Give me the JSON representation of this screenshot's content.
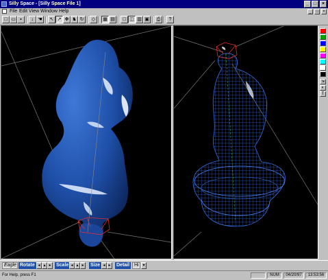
{
  "window": {
    "title": "Silly Space - [Silly Space File 1]"
  },
  "title_buttons": [
    "_",
    "□",
    "×"
  ],
  "menu": {
    "items": [
      "File",
      "Edit",
      "View",
      "Window",
      "Help"
    ]
  },
  "mdi_buttons": [
    "_",
    "□",
    "×"
  ],
  "toolbar": {
    "icons": [
      {
        "name": "new-file-icon",
        "glyph": "□"
      },
      {
        "name": "open-file-icon",
        "glyph": "▭"
      },
      {
        "name": "save-icon",
        "glyph": "▪"
      },
      {
        "name": "run-icon",
        "glyph": "↓"
      },
      {
        "name": "hand-icon",
        "glyph": "☚"
      },
      {
        "name": "select-arrow-icon",
        "glyph": "↖"
      },
      {
        "name": "pointer-icon",
        "glyph": "↗"
      },
      {
        "name": "fly-icon",
        "glyph": "✥"
      },
      {
        "name": "walk-icon",
        "glyph": "♞"
      },
      {
        "name": "rotate-icon",
        "glyph": "↻"
      },
      {
        "name": "view-toggle-icon",
        "glyph": "◇"
      },
      {
        "name": "grid-icon",
        "glyph": "▦"
      },
      {
        "name": "wireframe-icon",
        "glyph": "▤"
      },
      {
        "name": "single-view-icon",
        "glyph": "□"
      },
      {
        "name": "split-view-icon",
        "glyph": "◫"
      },
      {
        "name": "quad-view-icon",
        "glyph": "▥"
      },
      {
        "name": "fit-view-icon",
        "glyph": "▣"
      },
      {
        "name": "print-icon",
        "glyph": "⎙"
      },
      {
        "name": "help-icon",
        "glyph": "?"
      }
    ]
  },
  "palette": {
    "colors": [
      "#ff0000",
      "#00a000",
      "#0000ff",
      "#ffff00",
      "#ff00ff",
      "#00ffff",
      "#ffffff",
      "#000000"
    ],
    "tools": [
      "⇲",
      "◐",
      "T"
    ]
  },
  "controls": {
    "mode_label": "Eagle",
    "rotate_label": "Rotate",
    "scale_label": "Scale",
    "size_label": "Size",
    "detail_label": "Detail",
    "detail_value": "Hi"
  },
  "status": {
    "message": "For Help, press F1",
    "num": "NUM",
    "date": "04/20/97",
    "time": "13:53:56"
  }
}
